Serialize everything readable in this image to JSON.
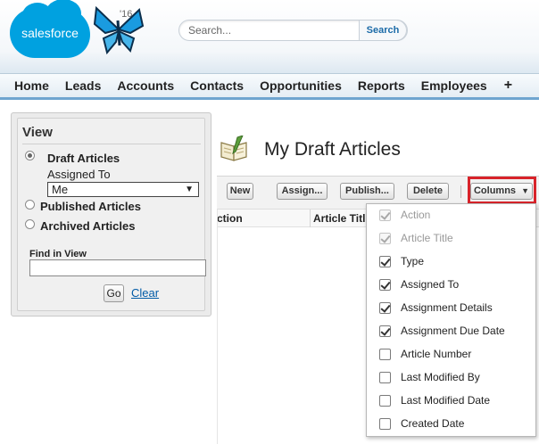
{
  "header": {
    "logo_text": "salesforce",
    "release": "'16",
    "search": {
      "placeholder": "Search...",
      "button_label": "Search"
    }
  },
  "tabs": [
    "Home",
    "Leads",
    "Accounts",
    "Contacts",
    "Opportunities",
    "Reports",
    "Employees",
    "+"
  ],
  "sidebar": {
    "title": "View",
    "draft_label": "Draft Articles",
    "assigned_to_label": "Assigned To",
    "assigned_to_value": "Me",
    "published_label": "Published Articles",
    "archived_label": "Archived Articles",
    "selected_view": "Draft Articles",
    "find_label": "Find in View",
    "find_value": "",
    "go_label": "Go",
    "clear_label": "Clear"
  },
  "main": {
    "title": "My Draft Articles",
    "toolbar": {
      "new": "New",
      "assign": "Assign...",
      "publish": "Publish...",
      "delete": "Delete",
      "columns": "Columns"
    },
    "column_headers": [
      "ction",
      "Article Title"
    ]
  },
  "columns_menu": [
    {
      "label": "Action",
      "checked": true,
      "disabled": true
    },
    {
      "label": "Article Title",
      "checked": true,
      "disabled": true
    },
    {
      "label": "Type",
      "checked": true,
      "disabled": false
    },
    {
      "label": "Assigned To",
      "checked": true,
      "disabled": false
    },
    {
      "label": "Assignment Details",
      "checked": true,
      "disabled": false
    },
    {
      "label": "Assignment Due Date",
      "checked": true,
      "disabled": false
    },
    {
      "label": "Article Number",
      "checked": false,
      "disabled": false
    },
    {
      "label": "Last Modified By",
      "checked": false,
      "disabled": false
    },
    {
      "label": "Last Modified Date",
      "checked": false,
      "disabled": false
    },
    {
      "label": "Created Date",
      "checked": false,
      "disabled": false
    }
  ],
  "colors": {
    "brand": "#00a1e0",
    "link": "#015ba7",
    "highlight": "#d8232a",
    "tab_underline": "#6fa5cf"
  }
}
